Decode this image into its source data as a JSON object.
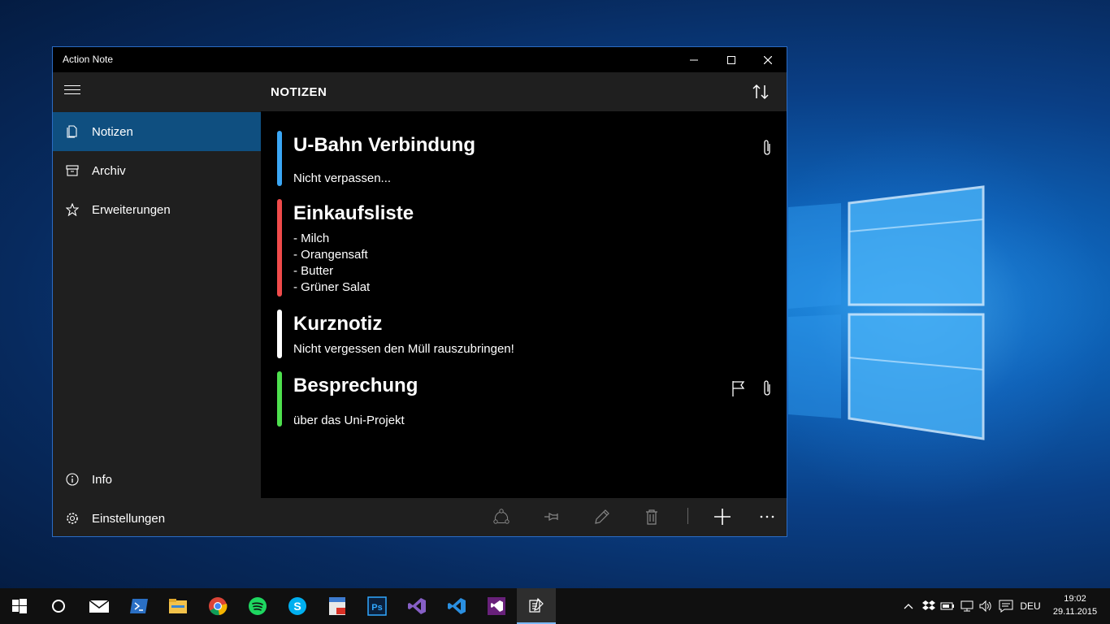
{
  "window": {
    "title": "Action Note"
  },
  "sidebar": {
    "items": [
      {
        "label": "Notizen",
        "icon": "notes-icon",
        "active": true
      },
      {
        "label": "Archiv",
        "icon": "archive-icon",
        "active": false
      },
      {
        "label": "Erweiterungen",
        "icon": "star-icon",
        "active": false
      }
    ],
    "bottom_items": [
      {
        "label": "Info",
        "icon": "info-icon"
      },
      {
        "label": "Einstellungen",
        "icon": "gear-icon"
      }
    ]
  },
  "header": {
    "title": "NOTIZEN",
    "sort_icon": "sort-icon"
  },
  "notes": [
    {
      "title": "U-Bahn Verbindung",
      "body": "Nicht verpassen...",
      "color": "#3ba7f5",
      "attachment": true,
      "flag": false
    },
    {
      "title": "Einkaufsliste",
      "body": "- Milch\n- Orangensaft\n- Butter\n- Grüner Salat",
      "color": "#f04b4b",
      "attachment": false,
      "flag": false
    },
    {
      "title": "Kurznotiz",
      "body": "Nicht vergessen den Müll rauszubringen!",
      "color": "#ffffff",
      "attachment": false,
      "flag": false
    },
    {
      "title": "Besprechung",
      "body": "über das Uni-Projekt",
      "color": "#4ee04e",
      "attachment": true,
      "flag": true
    }
  ],
  "appbar": [
    "share-icon",
    "pin-icon",
    "edit-icon",
    "delete-icon",
    "add-icon",
    "more-icon"
  ],
  "taskbar": {
    "apps": [
      "start-icon",
      "cortana-icon",
      "mail-icon",
      "powershell-icon",
      "file-explorer-icon",
      "chrome-icon",
      "spotify-icon",
      "skype-icon",
      "pdf-icon",
      "photoshop-icon",
      "visual-studio-icon",
      "vscode-icon",
      "visual-studio-preview-icon",
      "action-note-icon"
    ],
    "language": "DEU",
    "time": "19:02",
    "date": "29.11.2015"
  },
  "colors": {
    "accent": "#0f4f80",
    "sidebar_bg": "#1f1f1f",
    "content_bg": "#000000"
  }
}
